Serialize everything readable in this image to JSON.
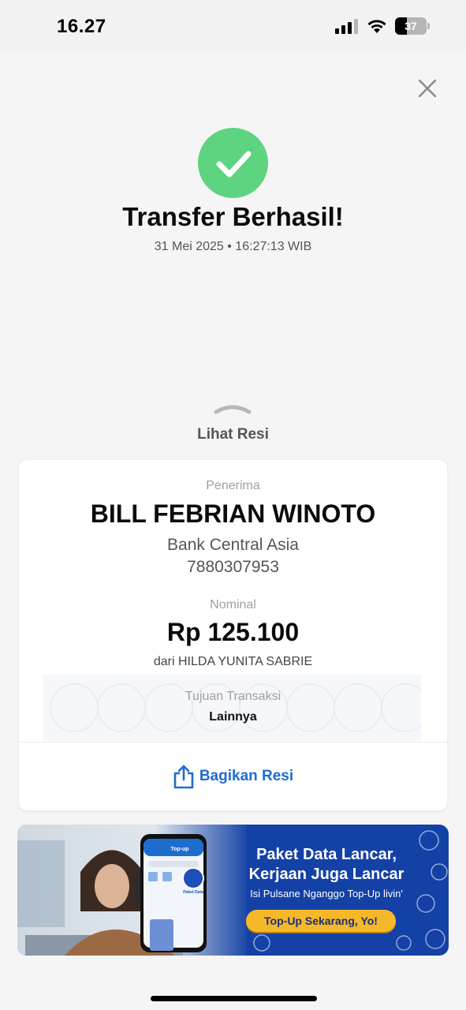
{
  "status_bar": {
    "time": "16.27",
    "battery": "37"
  },
  "header": {
    "title": "Transfer Berhasil!",
    "datetime": "31 Mei 2025 • 16:27:13 WIB",
    "success_color": "#5ed380"
  },
  "sheet": {
    "toggle_label": "Lihat Resi"
  },
  "receipt": {
    "recipient_label": "Penerima",
    "recipient_name": "BILL FEBRIAN WINOTO",
    "bank_name": "Bank Central Asia",
    "account_number": "7880307953",
    "amount_label": "Nominal",
    "amount": "Rp 125.100",
    "sender": "dari HILDA YUNITA SABRIE",
    "purpose_label": "Tujuan Transaksi",
    "purpose": "Lainnya",
    "share_label": "Bagikan Resi",
    "share_color": "#1f6ccf"
  },
  "banner": {
    "headline_1": "Paket Data Lancar,",
    "headline_2": "Kerjaan Juga Lancar",
    "subline": "Isi Pulsane Nganggo Top-Up livin'",
    "cta": "Top-Up Sekarang, Yo!",
    "phone_header": "Top-up",
    "phone_badge": "Paket Data"
  },
  "icons": {
    "close": "close-icon",
    "success": "check-circle-icon",
    "share": "share-icon",
    "chevron": "chevron-up-icon"
  }
}
